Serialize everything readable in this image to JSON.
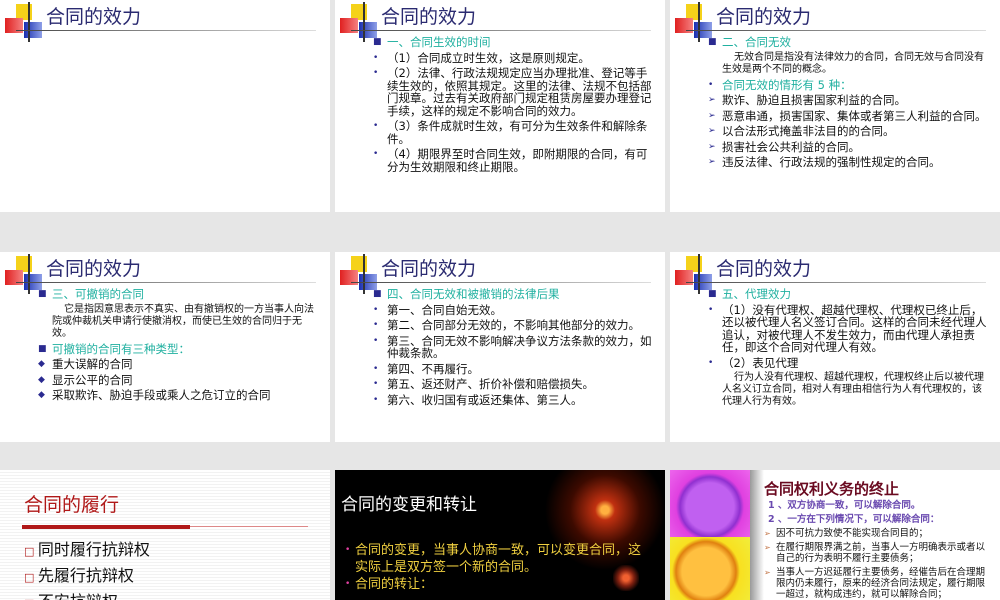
{
  "slides": [
    {
      "title": "合同的效力",
      "items": []
    },
    {
      "title": "合同的效力",
      "items": [
        {
          "b": "■",
          "t": "一、合同生效的时间",
          "c": "teal"
        },
        {
          "b": "•",
          "t": "（1）合同成立时生效，这是原则规定。"
        },
        {
          "b": "•",
          "t": "（2）法律、行政法规规定应当办理批准、登记等手续生效的，依照其规定。这里的法律、法规不包括部门规章。过去有关政府部门规定租赁房屋要办理登记手续，这样的规定不影响合同的效力。"
        },
        {
          "b": "•",
          "t": "（3）条件成就时生效，有可分为生效条件和解除条件。"
        },
        {
          "b": "•",
          "t": "（4）期限界至时合同生效，即附期限的合同，有可分为生效期限和终止期限。"
        }
      ]
    },
    {
      "title": "合同的效力",
      "items": [
        {
          "b": "■",
          "t": "二、合同无效",
          "c": "teal"
        },
        {
          "p": true,
          "t": "无效合同是指没有法律效力的合同，合同无效与合同没有生效是两个不同的概念。"
        },
        {
          "b": "•",
          "t": "合同无效的情形有 5 种：",
          "c": "teal"
        },
        {
          "b": "➢",
          "t": "欺诈、胁迫且损害国家利益的合同。"
        },
        {
          "b": "➢",
          "t": "恶意串通，损害国家、集体或者第三人利益的合同。"
        },
        {
          "b": "➢",
          "t": "以合法形式掩盖非法目的的合同。"
        },
        {
          "b": "➢",
          "t": "损害社会公共利益的合同。"
        },
        {
          "b": "➢",
          "t": "  违反法律、行政法规的强制性规定的合同。"
        }
      ]
    },
    {
      "title": "合同的效力",
      "items": [
        {
          "b": "■",
          "t": "三、可撤销的合同",
          "c": "teal"
        },
        {
          "p": true,
          "t": "它是指因意思表示不真实、由有撤销权的一方当事人向法院或仲裁机关申请行使撤消权，而使已生效的合同归于无效。"
        },
        {
          "b": "■",
          "t": "可撤销的合同有三种类型：",
          "c": "teal"
        },
        {
          "b": "◆",
          "t": "重大误解的合同"
        },
        {
          "b": "◆",
          "t": "显示公平的合同"
        },
        {
          "b": "◆",
          "t": "采取欺诈、胁迫手段或乘人之危订立的合同"
        }
      ]
    },
    {
      "title": "合同的效力",
      "items": [
        {
          "b": "■",
          "t": "四、合同无效和被撤销的法律后果",
          "c": "teal"
        },
        {
          "b": "•",
          "t": "第一、合同自始无效。"
        },
        {
          "b": "•",
          "t": "第二、合同部分无效的，不影响其他部分的效力。"
        },
        {
          "b": "•",
          "t": "第三、合同无效不影响解决争议方法条款的效力，如仲裁条款。"
        },
        {
          "b": "•",
          "t": "第四、不再履行。"
        },
        {
          "b": "•",
          "t": "第五、返还财产、折价补偿和赔偿损失。"
        },
        {
          "b": "•",
          "t": "第六、收归国有或返还集体、第三人。"
        }
      ]
    },
    {
      "title": "合同的效力",
      "items": [
        {
          "b": "■",
          "t": "五、代理效力",
          "c": "teal"
        },
        {
          "b": "•",
          "t": "（1）没有代理权、超越代理权、代理权已终止后，还以被代理人名义签订合同。这样的合同未经代理人追认，对被代理人不发生效力，而由代理人承担责任，即这个合同对代理人有效。"
        },
        {
          "b": "•",
          "t": "（2）表见代理"
        },
        {
          "p": true,
          "t": "行为人没有代理权、超越代理权，代理权终止后以被代理人名义订立合同，相对人有理由相信行为人有代理权的，该代理人行为有效。"
        }
      ]
    }
  ],
  "slide7": {
    "title": "合同的履行",
    "items": [
      "同时履行抗辩权",
      "先履行抗辩权",
      "不安抗辩权"
    ]
  },
  "slide8": {
    "title": "合同的变更和转让",
    "items": [
      "合同的变更，当事人协商一致，可以变更合同，这实际上是双方签一个新的合同。",
      "合同的转让："
    ]
  },
  "slide9": {
    "title": "合同权利义务的终止",
    "items": [
      {
        "t": "1 、双方协商一致，可以解除合同。",
        "c": "purple"
      },
      {
        "t": "2 、一方在下列情况下，可以解除合同：",
        "c": "purple"
      },
      {
        "t": "因不可抗力致使不能实现合同目的；",
        "b": "➢"
      },
      {
        "t": "在履行期限界满之前，当事人一方明确表示或者以自己的行为表明不履行主要债务；",
        "b": "➢"
      },
      {
        "t": "当事人一方迟延履行主要债务，经催告后在合理期限内仍未履行，原来的经济合同法规定，履行期限一超过，就构成违约，就可以解除合同；",
        "b": "➢"
      }
    ]
  }
}
